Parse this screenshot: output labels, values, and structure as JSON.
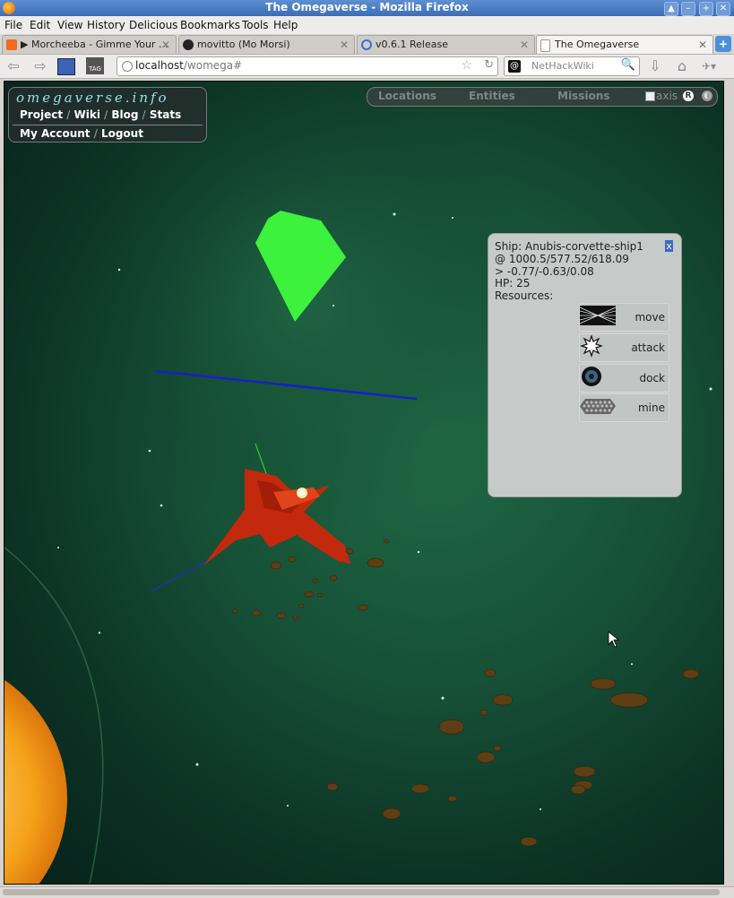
{
  "window": {
    "title": "The Omegaverse - Mozilla Firefox"
  },
  "menu": [
    "File",
    "Edit",
    "View",
    "History",
    "Delicious",
    "Bookmarks",
    "Tools",
    "Help"
  ],
  "tabs": [
    {
      "label": "▶ Morcheeba - Gimme Your ...",
      "icon": "soundcloud-icon",
      "active": false
    },
    {
      "label": "movitto (Mo Morsi)",
      "icon": "github-icon",
      "active": false
    },
    {
      "label": "v0.6.1 Release",
      "icon": "loading-icon",
      "active": false
    },
    {
      "label": "The Omegaverse",
      "icon": "blank-page-icon",
      "active": true
    }
  ],
  "nav": {
    "url_host": "localhost",
    "url_path": "/womega#",
    "search_engine": "@",
    "search_placeholder": "NetHackWiki"
  },
  "site_menu": {
    "logo": "omegaverse.info",
    "links": [
      "Project",
      "Wiki",
      "Blog",
      "Stats"
    ],
    "account_links": [
      "My Account",
      "Logout"
    ]
  },
  "top_nav": {
    "items": [
      "Locations",
      "Entities",
      "Missions"
    ],
    "axis_label": "axis",
    "axis_checked": false,
    "reset_label": "R"
  },
  "entity_panel": {
    "ship": "Ship: Anubis-corvette-ship1",
    "position": "@ 1000.5/577.52/618.09",
    "orientation": "> -0.77/-0.63/0.08",
    "hp": "HP: 25",
    "resources": "Resources:",
    "close": "x",
    "commands": [
      {
        "label": "move",
        "icon": "move-icon"
      },
      {
        "label": "attack",
        "icon": "attack-icon"
      },
      {
        "label": "dock",
        "icon": "dock-icon"
      },
      {
        "label": "mine",
        "icon": "mine-icon"
      }
    ]
  },
  "colors": {
    "space_bg": "#164f36",
    "gem": "#3cf23c",
    "ship": "#c3290c",
    "sun": "#f5a11a",
    "path_line": "#1820c8"
  }
}
